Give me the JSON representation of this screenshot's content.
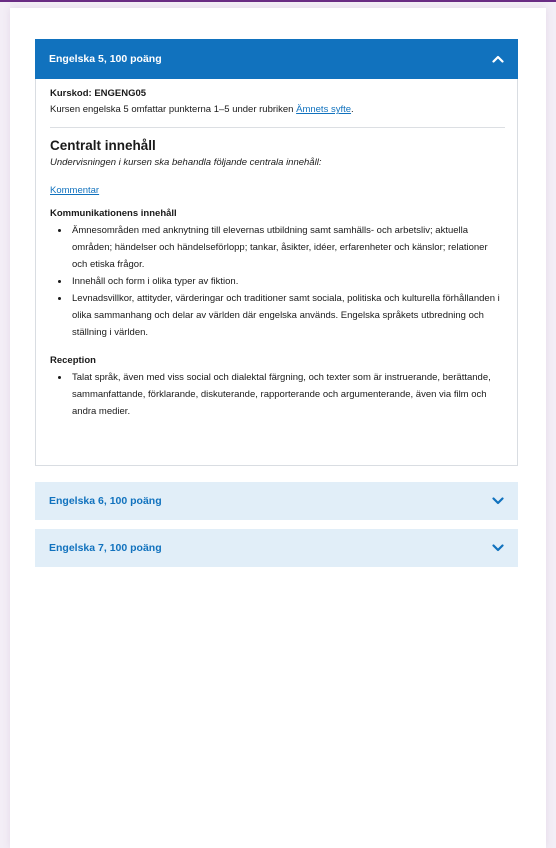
{
  "colors": {
    "accent": "#1172be",
    "closed_header_bg": "#e1eef8",
    "top_line": "#6a2c84"
  },
  "open_section": {
    "title": "Engelska 5, 100 poäng",
    "toggle_icon": "chevron-up-icon",
    "course_code": "Kurskod: ENGENG05",
    "description_prefix": "Kursen engelska 5 omfattar punkterna 1–5 under rubriken ",
    "description_link": "Ämnets syfte",
    "description_suffix": ".",
    "central_title": "Centralt innehåll",
    "central_subtitle": "Undervisningen i kursen ska behandla följande centrala innehåll:",
    "comment_link": "Kommentar",
    "groups": [
      {
        "title": "Kommunikationens innehåll",
        "items": [
          "Ämnesområden med anknytning till elevernas utbildning samt samhälls- och arbetsliv; aktuella områden; händelser och händelseförlopp; tankar, åsikter, idéer, erfarenheter och känslor; relationer och etiska frågor.",
          "Innehåll och form i olika typer av fiktion.",
          "Levnadsvillkor, attityder, värderingar och traditioner samt sociala, politiska och kulturella förhållanden i olika sammanhang och delar av världen där engelska används. Engelska språkets utbredning och ställning i världen."
        ]
      },
      {
        "title": "Reception",
        "items": [
          "Talat språk, även med viss social och dialektal färgning, och texter som är instruerande, berättande, sammanfattande, förklarande, diskuterande, rapporterande och argumenterande, även via film och andra medier."
        ]
      }
    ]
  },
  "closed_sections": [
    {
      "title": "Engelska 6, 100 poäng",
      "toggle_icon": "chevron-down-icon"
    },
    {
      "title": "Engelska 7, 100 poäng",
      "toggle_icon": "chevron-down-icon"
    }
  ]
}
